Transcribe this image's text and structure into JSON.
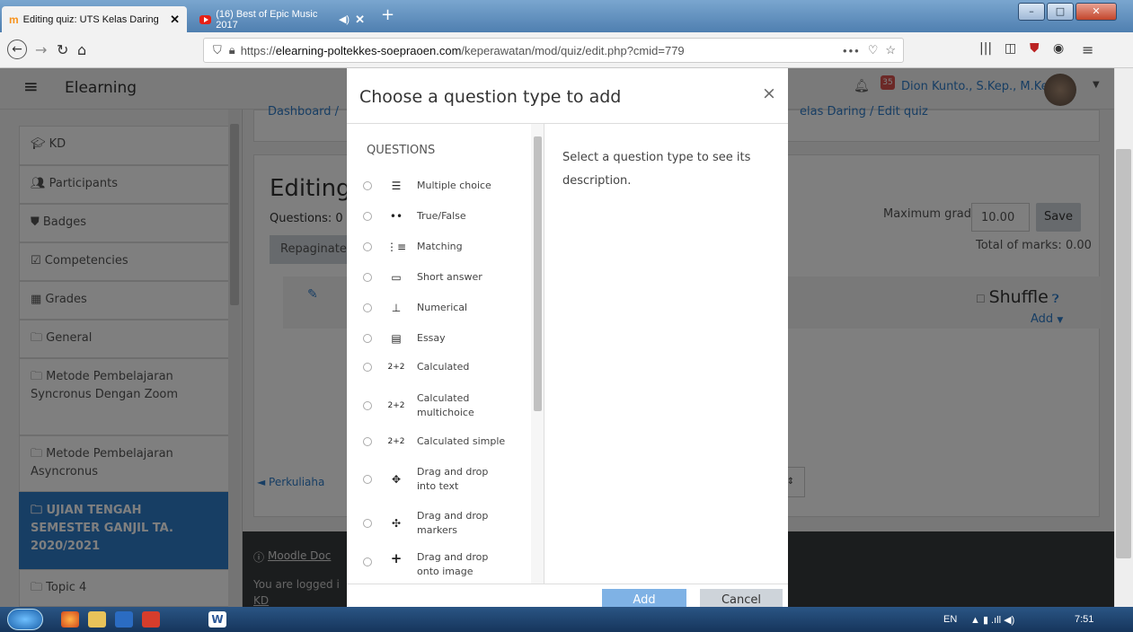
{
  "browser": {
    "tabs": [
      {
        "label": "Editing quiz: UTS Kelas Daring"
      },
      {
        "label": "(16) Best of Epic Music 2017"
      }
    ],
    "url_prefix": "https://",
    "url_host": "elearning-poltekkes-soepraoen.com",
    "url_path": "/keperawatan/mod/quiz/edit.php?cmid=779"
  },
  "header": {
    "brand": "Elearning",
    "notification_count": "35",
    "user_name": "Dion Kunto., S.Kep., M.Kep"
  },
  "breadcrumb": {
    "first": "Dashboard /",
    "last": "elas Daring  /  Edit quiz"
  },
  "sidebar": {
    "items": [
      {
        "label": "KD",
        "icon": "graduation-cap-icon"
      },
      {
        "label": "Participants",
        "icon": "users-icon"
      },
      {
        "label": "Badges",
        "icon": "shield-icon"
      },
      {
        "label": "Competencies",
        "icon": "checkbox-icon"
      },
      {
        "label": "Grades",
        "icon": "table-icon"
      },
      {
        "label": "General",
        "icon": "folder-icon"
      },
      {
        "label": "Metode Pembelajaran Syncronus Dengan Zoom",
        "icon": "folder-icon"
      },
      {
        "label": "Metode Pembelajaran Asyncronus",
        "icon": "folder-icon"
      },
      {
        "label": "UJIAN TENGAH SEMESTER GANJIL TA. 2020/2021",
        "icon": "folder-icon"
      },
      {
        "label": "Topic 4",
        "icon": "folder-icon"
      }
    ]
  },
  "main": {
    "title": "Editing",
    "questions_label": "Questions: 0 |",
    "repaginate": "Repaginate",
    "max_grade_label": "Maximum grade",
    "max_grade_value": "10.00",
    "save": "Save",
    "total_marks": "Total of marks: 0.00",
    "shuffle": "Shuffle",
    "add": "Add",
    "prev_link": "◄ Perkuliaha",
    "footer_doc": "Moodle Doc",
    "footer_logged": "You are logged i",
    "footer_kd": "KD"
  },
  "modal": {
    "title": "Choose a question type to add",
    "section": "QUESTIONS",
    "description": "Select a question type to see its description.",
    "add": "Add",
    "cancel": "Cancel",
    "question_types": [
      {
        "label": "Multiple choice",
        "icon": "list-icon"
      },
      {
        "label": "True/False",
        "icon": "dots-icon"
      },
      {
        "label": "Matching",
        "icon": "matching-icon"
      },
      {
        "label": "Short answer",
        "icon": "short-answer-icon"
      },
      {
        "label": "Numerical",
        "icon": "numerical-icon"
      },
      {
        "label": "Essay",
        "icon": "essay-icon"
      },
      {
        "label": "Calculated",
        "icon": "calculated-icon"
      },
      {
        "label": "Calculated multichoice",
        "icon": "calculated-multichoice-icon"
      },
      {
        "label": "Calculated simple",
        "icon": "calculated-simple-icon"
      },
      {
        "label": "Drag and drop into text",
        "icon": "move-icon"
      },
      {
        "label": "Drag and drop markers",
        "icon": "move-markers-icon"
      },
      {
        "label": "Drag and drop onto image",
        "icon": "plus-icon"
      }
    ]
  },
  "taskbar": {
    "lang": "EN",
    "time": "7:51"
  }
}
